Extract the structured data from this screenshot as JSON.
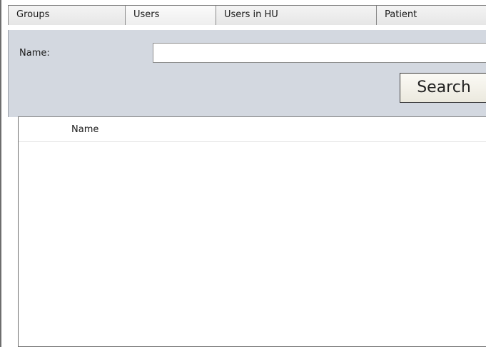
{
  "tabs": [
    {
      "label": "Groups",
      "active": false
    },
    {
      "label": "Users",
      "active": true
    },
    {
      "label": "Users in HU",
      "active": false
    },
    {
      "label": "Patient",
      "active": false
    }
  ],
  "search_form": {
    "name_label": "Name:",
    "name_value": "",
    "search_label": "Search"
  },
  "results": {
    "columns": [
      "",
      "Name"
    ],
    "rows": []
  }
}
